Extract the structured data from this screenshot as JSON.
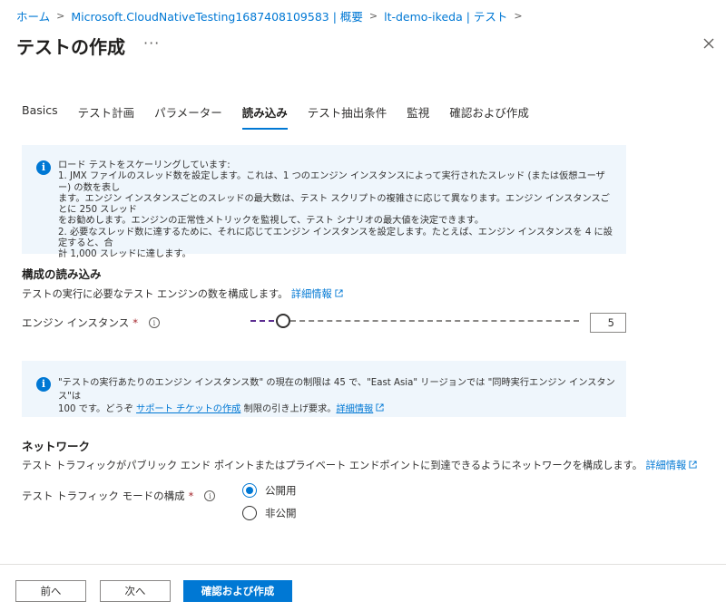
{
  "breadcrumb": [
    {
      "label": "ホーム"
    },
    {
      "label": "Microsoft.CloudNativeTesting1687408109583 | 概要"
    },
    {
      "label": "lt-demo-ikeda | テスト"
    }
  ],
  "page": {
    "title": "テストの作成",
    "more": "···"
  },
  "tabs": [
    {
      "label": "Basics"
    },
    {
      "label": "テスト計画"
    },
    {
      "label": "パラメーター"
    },
    {
      "label": "読み込み"
    },
    {
      "label": "テスト抽出条件"
    },
    {
      "label": "監視"
    },
    {
      "label": "確認および作成"
    }
  ],
  "info_scaling": {
    "lines": [
      "ロード テストをスケーリングしています:",
      "1. JMX ファイルのスレッド数を設定します。これは、1 つのエンジン インスタンスによって実行されたスレッド (または仮想ユーザー) の数を表し",
      "ます。エンジン インスタンスごとのスレッドの最大数は、テスト スクリプトの複雑さに応じて異なります。エンジン インスタンスごとに 250 スレッド",
      "をお勧めします。エンジンの正常性メトリックを監視して、テスト シナリオの最大値を決定できます。",
      "2. 必要なスレッド数に達するために、それに応じてエンジン インスタンスを設定します。たとえば、エンジン インスタンスを 4 に設定すると、合",
      "計 1,000 スレッドに達します。"
    ]
  },
  "load_config": {
    "heading": "構成の読み込み",
    "description": "テストの実行に必要なテスト エンジンの数を構成します。",
    "learn_more": "詳細情報",
    "engine_label": "エンジン インスタンス",
    "required_mark": "*",
    "engine_value": "5",
    "slider_fraction": 0.08
  },
  "info_limit": {
    "line1": "\"テストの実行あたりのエンジン インスタンス数\" の現在の制限は 45 で、\"East Asia\" リージョンでは \"同時実行エンジン インスタンス\"は",
    "line2_prefix": "100 です。どうぞ",
    "support_link": "サポート チケットの作成",
    "line2_middle": "制限の引き上げ要求。",
    "learn_more": "詳細情報"
  },
  "network": {
    "heading": "ネットワーク",
    "description": "テスト トラフィックがパブリック エンド ポイントまたはプライベート エンドポイントに到達できるようにネットワークを構成します。",
    "learn_more": "詳細情報",
    "mode_label": "テスト トラフィック モードの構成",
    "required_mark": "*",
    "options": [
      {
        "label": "公開用",
        "selected": true
      },
      {
        "label": "非公開",
        "selected": false
      }
    ]
  },
  "footer": {
    "prev": "前へ",
    "next": "次へ",
    "review": "確認および作成"
  },
  "colors": {
    "accent": "#0078d4",
    "slider_fill": "#5c2d91",
    "info_bg": "#eff6fc",
    "required": "#a4262c"
  }
}
